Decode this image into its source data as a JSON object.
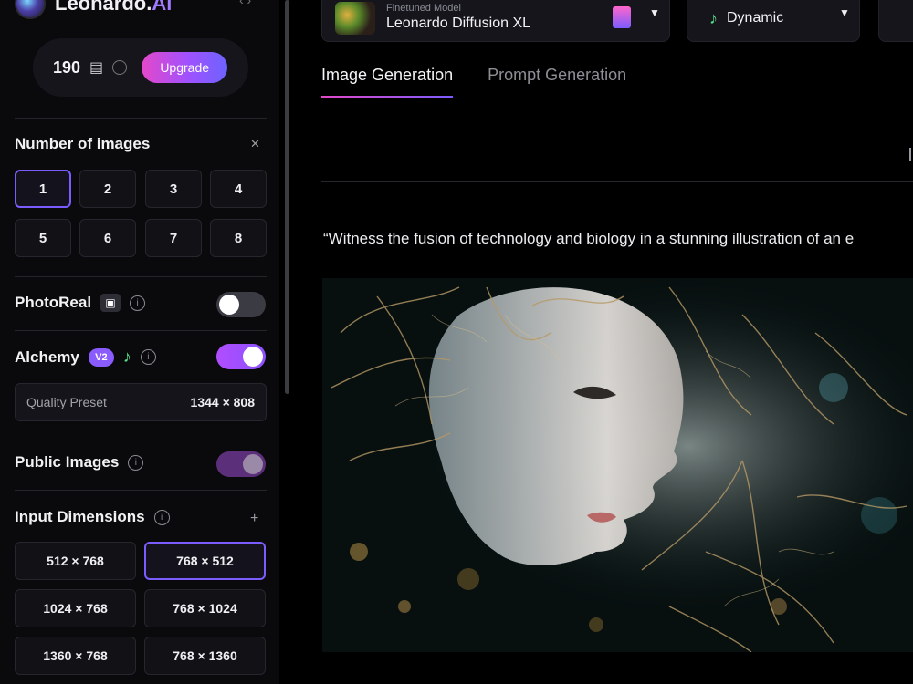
{
  "app": {
    "name_main": "Leonardo.",
    "name_ai": "Ai"
  },
  "tokens": {
    "count": "190",
    "upgrade_label": "Upgrade"
  },
  "number_of_images": {
    "title": "Number of images",
    "options": [
      "1",
      "2",
      "3",
      "4",
      "5",
      "6",
      "7",
      "8"
    ],
    "selected": "1"
  },
  "photoreal": {
    "label": "PhotoReal",
    "enabled": false
  },
  "alchemy": {
    "label": "Alchemy",
    "badge": "V2",
    "enabled": true
  },
  "preset": {
    "label": "Quality Preset",
    "value": "1344 × 808"
  },
  "public_images": {
    "label": "Public Images",
    "enabled": true
  },
  "dimensions": {
    "title": "Input Dimensions",
    "options": [
      "512 × 768",
      "768 × 512",
      "1024 × 768",
      "768 × 1024",
      "1360 × 768",
      "768 × 1360"
    ],
    "selected": "768 × 512"
  },
  "model": {
    "sub": "Finetuned Model",
    "name": "Leonardo Diffusion XL"
  },
  "style": {
    "name": "Dynamic"
  },
  "tabs": [
    {
      "label": "Image Generation",
      "active": true
    },
    {
      "label": "Prompt Generation",
      "active": false
    }
  ],
  "prompt": {
    "text": "“Witness the fusion of technology and biology in a stunning illustration of an e"
  },
  "colors": {
    "accent": "#7b5cff",
    "pink": "#e448c9",
    "leaf": "#56e28a"
  },
  "icons": [
    "close-icon",
    "info-icon",
    "plus-icon",
    "chevron-down-icon",
    "leaf-icon",
    "clock-icon",
    "token-icon"
  ]
}
